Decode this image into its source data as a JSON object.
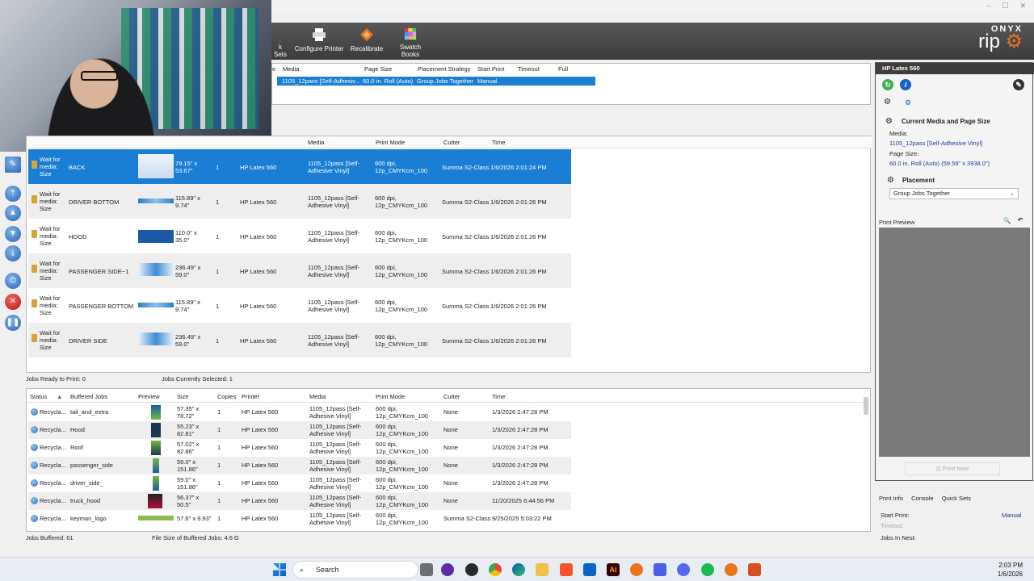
{
  "window": {
    "minimize": "–",
    "maximize": "☐",
    "close": "✕"
  },
  "toolbar": {
    "partial_label": "k Sets",
    "buttons": [
      {
        "label": "Configure Printer"
      },
      {
        "label": "Recalibrate"
      },
      {
        "label": "Swatch Books"
      }
    ],
    "logo_top": "ONYX",
    "logo_bottom": "rip"
  },
  "job_setup": {
    "headers": [
      "e",
      "Media",
      "Page Size",
      "Placement Strategy",
      "Start Print",
      "Timeout",
      "Full"
    ],
    "row": {
      "media": "1105_12pass [Self-Adhesiv...",
      "page_size": "60.0 in. Roll (Auto)",
      "placement": "Group Jobs Together",
      "start_print": "Manual"
    }
  },
  "queue": {
    "headers": [
      "Media",
      "Print Mode",
      "Cutter",
      "Time"
    ],
    "rows": [
      {
        "status": "Wait for media: Size",
        "name": "BACK",
        "size": "79.15\" x 53.67\"",
        "copies": "1",
        "printer": "HP Latex 560",
        "media": "1105_12pass [Self-Adhesive Vinyl]",
        "mode": "600 dpi, 12p_CMYKcm_100",
        "cutter": "Summa S2-Class",
        "time": "1/6/2026 2:01:24 PM"
      },
      {
        "status": "Wait for media: Size",
        "name": "DRIVER BOTTOM",
        "size": "115.89\" x 9.74\"",
        "copies": "1",
        "printer": "HP Latex 560",
        "media": "1105_12pass [Self-Adhesive Vinyl]",
        "mode": "600 dpi, 12p_CMYKcm_100",
        "cutter": "Summa S2-Class",
        "time": "1/6/2026 2:01:26 PM"
      },
      {
        "status": "Wait for media: Size",
        "name": "HOOD",
        "size": "110.0\" x 35.0\"",
        "copies": "1",
        "printer": "HP Latex 560",
        "media": "1105_12pass [Self-Adhesive Vinyl]",
        "mode": "600 dpi, 12p_CMYKcm_100",
        "cutter": "Summa S2-Class",
        "time": "1/6/2026 2:01:26 PM"
      },
      {
        "status": "Wait for media: Size",
        "name": "PASSENGER SIDE~1",
        "size": "236.49\" x 59.0\"",
        "copies": "1",
        "printer": "HP Latex 560",
        "media": "1105_12pass [Self-Adhesive Vinyl]",
        "mode": "600 dpi, 12p_CMYKcm_100",
        "cutter": "Summa S2-Class",
        "time": "1/6/2026 2:01:26 PM"
      },
      {
        "status": "Wait for media: Size",
        "name": "PASSENGER BOTTOM",
        "size": "115.89\" x 9.74\"",
        "copies": "1",
        "printer": "HP Latex 560",
        "media": "1105_12pass [Self-Adhesive Vinyl]",
        "mode": "600 dpi, 12p_CMYKcm_100",
        "cutter": "Summa S2-Class",
        "time": "1/6/2026 2:01:26 PM"
      },
      {
        "status": "Wait for media: Size",
        "name": "DRIVER SIDE",
        "size": "236.49\" x 59.0\"",
        "copies": "1",
        "printer": "HP Latex 560",
        "media": "1105_12pass [Self-Adhesive Vinyl]",
        "mode": "600 dpi, 12p_CMYKcm_100",
        "cutter": "Summa S2-Class",
        "time": "1/6/2026 2:01:26 PM"
      }
    ],
    "ready": "Jobs Ready to Print: 0",
    "selected": "Jobs Currently Selected: 1"
  },
  "buffered": {
    "headers": [
      "Status",
      "Buffered Jobs",
      "Preview",
      "Size",
      "Copies",
      "Printer",
      "Media",
      "Print Mode",
      "Cutter",
      "Time"
    ],
    "rows": [
      {
        "status": "Recycla...",
        "name": "tail_and_extra",
        "size": "57.35\" x 78.72\"",
        "copies": "1",
        "printer": "HP Latex 560",
        "media": "1105_12pass [Self-Adhesive Vinyl]",
        "mode": "600 dpi, 12p_CMYKcm_100",
        "cutter": "None",
        "time": "1/3/2026 2:47:28 PM"
      },
      {
        "status": "Recycla...",
        "name": "Hood",
        "size": "55.23\" x 82.81\"",
        "copies": "1",
        "printer": "HP Latex 560",
        "media": "1105_12pass [Self-Adhesive Vinyl]",
        "mode": "600 dpi, 12p_CMYKcm_100",
        "cutter": "None",
        "time": "1/3/2026 2:47:28 PM"
      },
      {
        "status": "Recycla...",
        "name": "Roof",
        "size": "57.02\" x 82.86\"",
        "copies": "1",
        "printer": "HP Latex 560",
        "media": "1105_12pass [Self-Adhesive Vinyl]",
        "mode": "600 dpi, 12p_CMYKcm_100",
        "cutter": "None",
        "time": "1/3/2026 2:47:28 PM"
      },
      {
        "status": "Recycla...",
        "name": "passenger_side",
        "size": "59.0\" x 151.86\"",
        "copies": "1",
        "printer": "HP Latex 560",
        "media": "1105_12pass [Self-Adhesive Vinyl]",
        "mode": "600 dpi, 12p_CMYKcm_100",
        "cutter": "None",
        "time": "1/3/2026 2:47:28 PM"
      },
      {
        "status": "Recycla...",
        "name": "driver_side_",
        "size": "59.0\" x 151.86\"",
        "copies": "1",
        "printer": "HP Latex 560",
        "media": "1105_12pass [Self-Adhesive Vinyl]",
        "mode": "600 dpi, 12p_CMYKcm_100",
        "cutter": "None",
        "time": "1/3/2026 2:47:28 PM"
      },
      {
        "status": "Recycla...",
        "name": "truck_hood",
        "size": "56.37\" x 50.5\"",
        "copies": "1",
        "printer": "HP Latex 560",
        "media": "1105_12pass [Self-Adhesive Vinyl]",
        "mode": "600 dpi, 12p_CMYKcm_100",
        "cutter": "None",
        "time": "11/20/2025 6:44:56 PM"
      },
      {
        "status": "Recycla...",
        "name": "keyman_logo",
        "size": "57.6\" x 9.93\"",
        "copies": "1",
        "printer": "HP Latex 560",
        "media": "1105_12pass [Self-Adhesive Vinyl]",
        "mode": "600 dpi, 12p_CMYKcm_100",
        "cutter": "Summa S2-Class",
        "time": "9/25/2025 5:03:22 PM"
      }
    ],
    "jobs_buffered": "Jobs Buffered: 61",
    "file_size": "File Size of Buffered Jobs: 4.6 G"
  },
  "right_panel": {
    "title": "HP Latex 560",
    "section1": "Current Media and Page Size",
    "media_label": "Media:",
    "media_value": "1105_12pass [Self-Adhesive Vinyl]",
    "page_label": "Page Size:",
    "page_value": "60.0 in. Roll (Auto) (59.59\" x 3938.0\")",
    "section2": "Placement",
    "placement_value": "Group Jobs Together",
    "print_preview": "Print Preview",
    "print_now": "Print Now"
  },
  "bottom_panel": {
    "tabs": [
      "Print Info",
      "Console",
      "Quick Sets"
    ],
    "start_print_label": "Start Print:",
    "start_print_value": "Manual",
    "timeout_label": "Timeout:",
    "jobs_in_nest_label": "Jobs In Nest:"
  },
  "taskbar": {
    "search": "Search",
    "time": "2:03 PM",
    "date": "1/6/2026"
  }
}
